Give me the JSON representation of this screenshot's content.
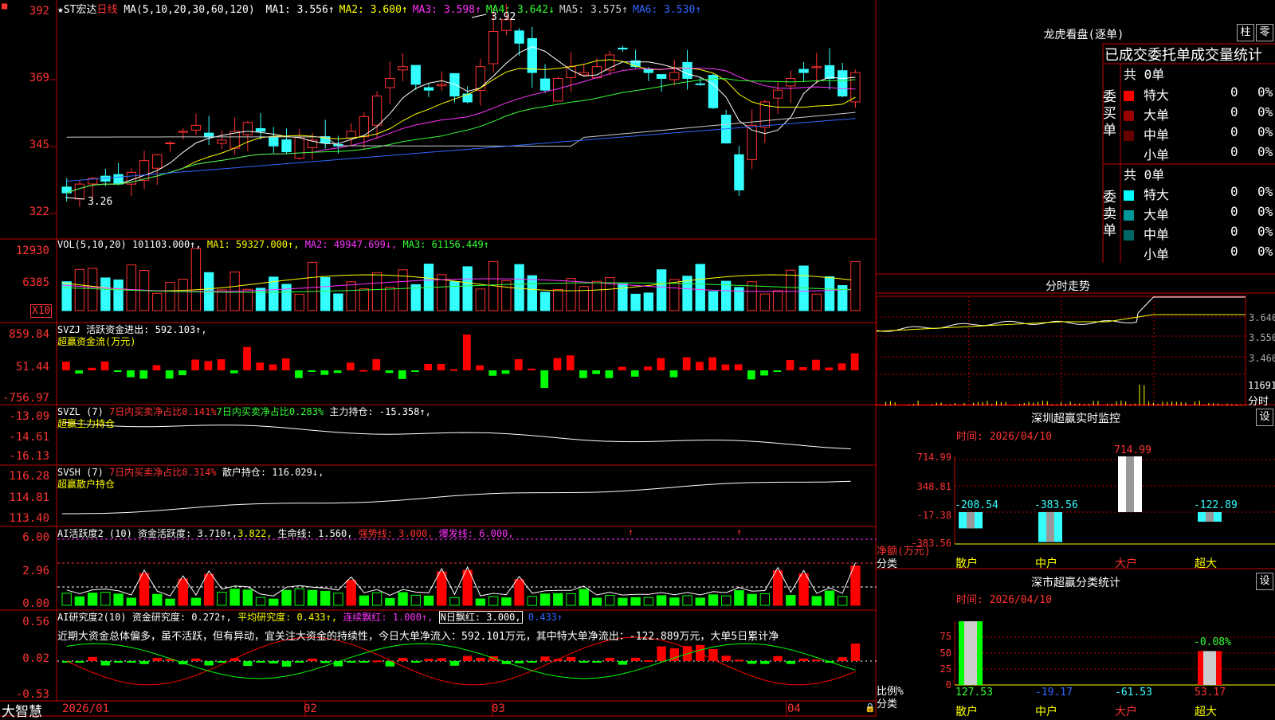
{
  "app": {
    "brand": "大智慧"
  },
  "main": {
    "stock": "★ST宏达",
    "period": "日线",
    "ma_params": "MA(5,10,20,30,60,120)",
    "ma_values": [
      {
        "label": "MA1:",
        "value": "3.556↑",
        "color": "#ffffff"
      },
      {
        "label": "MA2:",
        "value": "3.600↑",
        "color": "#ffff00"
      },
      {
        "label": "MA3:",
        "value": "3.598↑",
        "color": "#ff33ff"
      },
      {
        "label": "MA4:",
        "value": "3.642↓",
        "color": "#33ff33"
      },
      {
        "label": "MA5:",
        "value": "3.575↑",
        "color": "#cccccc"
      },
      {
        "label": "MA6:",
        "value": "3.530↑",
        "color": "#3366ff"
      }
    ],
    "y_ticks": [
      "392",
      "369",
      "345",
      "322"
    ],
    "hi_mark": "3.92",
    "lo_mark": "3.26",
    "dates": [
      "2026/01",
      "02",
      "03",
      "04"
    ]
  },
  "vol": {
    "title": "VOL(5,10,20)",
    "value": "101103.000↑,",
    "ma1": "MA1: 59327.000↑,",
    "ma2": "MA2: 49947.699↓,",
    "ma3": "MA3: 61156.449↑",
    "y_ticks": [
      "12930",
      "6385"
    ],
    "unit": "X10"
  },
  "svzj": {
    "title": "SVZJ",
    "label": "活跃资金进出: 592.103↑,",
    "name": "超赢资金流(万元)",
    "y_ticks": [
      "859.84",
      "51.44",
      "-756.97"
    ]
  },
  "svzl": {
    "title": "SVZL (7)",
    "t1": "7日内买卖净占比0.141%",
    "t2": "7日内买卖净占比0.283%",
    "t3": "主力持仓: -15.358↑,",
    "name": "超赢主力持仓",
    "y_ticks": [
      "-13.09",
      "-14.61",
      "-16.13"
    ]
  },
  "svsh": {
    "title": "SVSH (7)",
    "t1": "7日内买卖净占比0.314%",
    "t2": "散户持仓: 116.029↓,",
    "name": "超赢散户持仓",
    "y_ticks": [
      "116.28",
      "114.81",
      "113.40"
    ]
  },
  "ai1": {
    "title": "AI活跃度2 (10)",
    "t1": "资金活跃度: 3.710↑,",
    "t2": "3.822,",
    "t3": "生命线: 1.560,",
    "t4": "强势线: 3.000,",
    "t5": "爆发线: 6.000,",
    "y_ticks": [
      "6.00",
      "2.96",
      "0.00"
    ]
  },
  "ai2": {
    "title": "AI研究度2(10)",
    "t1": "资金研究度: 0.272↑,",
    "t2": "平均研究度: 0.433↑,",
    "t3": "连续飘红: 1.000↑,",
    "t4": "N日飘红: 3.000,",
    "t5": "0.433↑",
    "comment": "近期大资金总体偏多，虽不活跃，但有异动，宜关注大资金的持续性，今日大单净流入：592.101万元，其中特大单净流出：-122.889万元，大单5日累计净",
    "y_ticks": [
      "0.56",
      "0.02",
      "-0.53"
    ]
  },
  "orderbook": {
    "title": "龙虎看盘(逐单)",
    "btn1": "柱",
    "btn2": "零",
    "subtitle": "已成交委托单成交量统计",
    "buy_side": "委买单",
    "sell_side": "委卖单",
    "buy_total": "共 0单",
    "sell_total": "共 0单",
    "rows": [
      {
        "label": "特大",
        "count": "0",
        "pct": "0%"
      },
      {
        "label": "大单",
        "count": "0",
        "pct": "0%"
      },
      {
        "label": "中单",
        "count": "0",
        "pct": "0%"
      },
      {
        "label": "小单",
        "count": "0",
        "pct": "0%"
      }
    ],
    "buy_colors": [
      "#ff0000",
      "#990000",
      "#660000",
      ""
    ],
    "sell_colors": [
      "#00ffff",
      "#009999",
      "#006666",
      ""
    ]
  },
  "intraday": {
    "title": "分时走势",
    "y_ticks": [
      "3.640",
      "3.550",
      "3.460"
    ],
    "vol_tick": "11691",
    "vol_unit": "分时"
  },
  "monitor": {
    "title": "深圳超赢实时监控",
    "btn": "设",
    "time": "时间: 2026/04/10",
    "y_ticks": [
      "714.99",
      "348.81",
      "-17.38",
      "-383.56"
    ],
    "axis_label": "净额(万元)",
    "axis_label2": "分类",
    "cats": [
      "散户",
      "中户",
      "大户",
      "超大"
    ],
    "values": [
      -208.54,
      -383.56,
      714.99,
      -122.89
    ],
    "value_labels": [
      "-208.54",
      "-383.56",
      "714.99",
      "-122.89"
    ]
  },
  "classify": {
    "title": "深市超赢分类统计",
    "btn": "设",
    "time": "时间: 2026/04/10",
    "y_ticks": [
      "75",
      "50",
      "25",
      "0"
    ],
    "axis_label": "比例%",
    "axis_label2": "分类",
    "cats": [
      "散户",
      "中户",
      "大户",
      "超大"
    ],
    "values": [
      127.53,
      -19.17,
      -61.53,
      53.17
    ],
    "value_labels": [
      "127.53",
      "-19.17",
      "-61.53",
      "53.17"
    ],
    "extra_label": "-0.08%"
  }
}
